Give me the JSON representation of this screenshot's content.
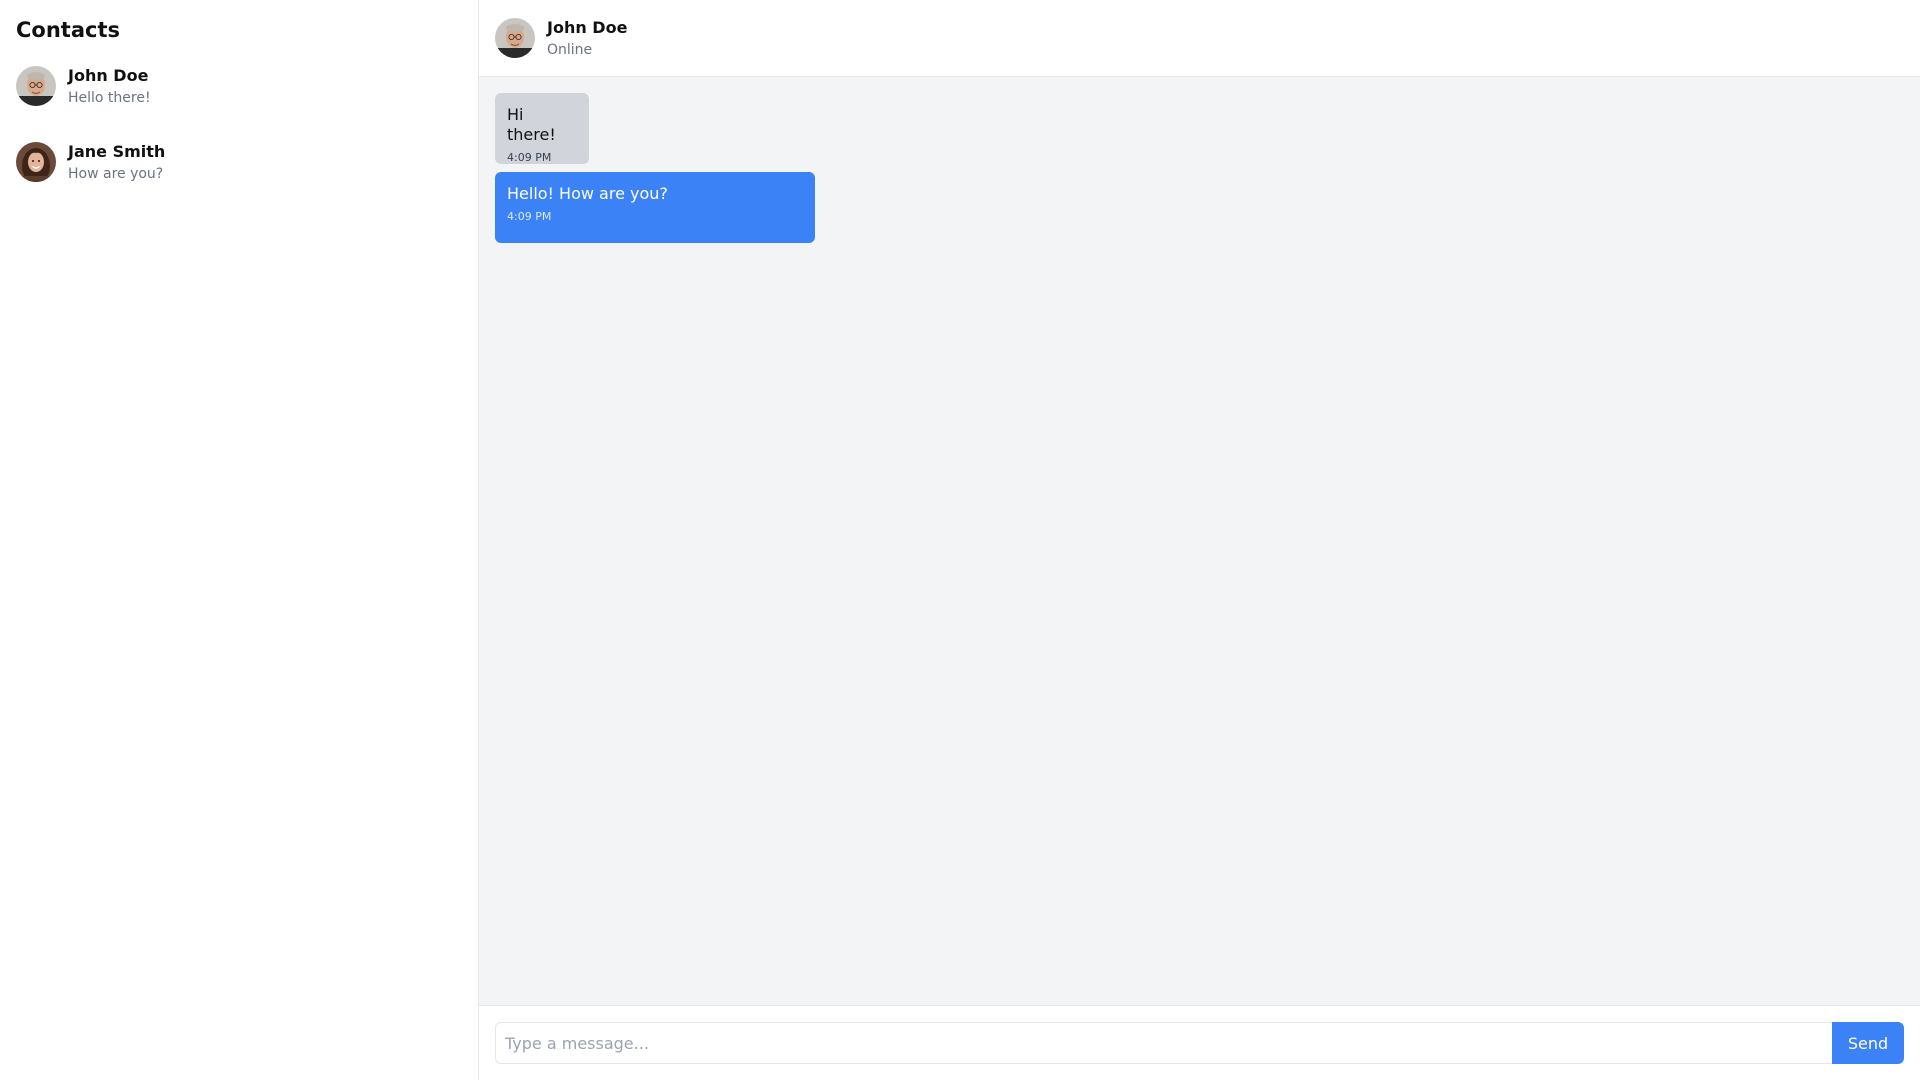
{
  "sidebar": {
    "title": "Contacts",
    "contacts": [
      {
        "name": "John Doe",
        "preview": "Hello there!",
        "avatar": "avatar-man-glasses-icon"
      },
      {
        "name": "Jane Smith",
        "preview": "How are you?",
        "avatar": "avatar-woman-icon"
      }
    ]
  },
  "chat": {
    "header": {
      "name": "John Doe",
      "status": "Online",
      "avatar": "avatar-man-glasses-icon"
    },
    "messages": [
      {
        "direction": "received",
        "text": "Hi there!",
        "time": "4:09 PM"
      },
      {
        "direction": "sent",
        "text": "Hello! How are you?",
        "time": "4:09 PM"
      }
    ],
    "composer": {
      "placeholder": "Type a message...",
      "value": "",
      "send_label": "Send"
    }
  },
  "colors": {
    "accent": "#3b82f6",
    "received_bubble": "#d1d5db",
    "chat_background": "#f3f4f6",
    "muted_text": "#6b7280"
  }
}
